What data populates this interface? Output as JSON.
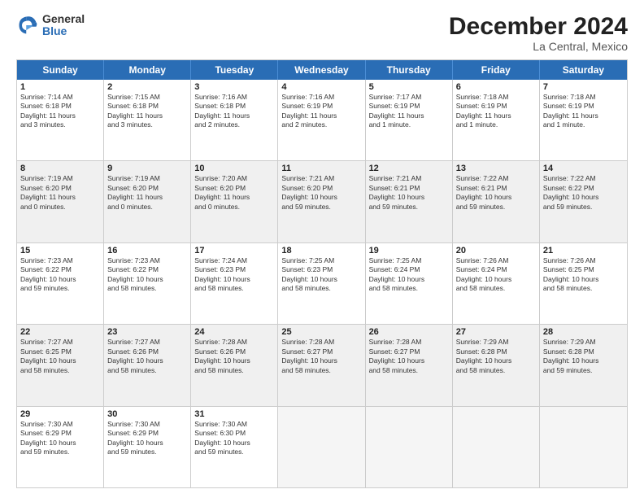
{
  "header": {
    "logo_general": "General",
    "logo_blue": "Blue",
    "title": "December 2024",
    "location": "La Central, Mexico"
  },
  "calendar": {
    "days": [
      "Sunday",
      "Monday",
      "Tuesday",
      "Wednesday",
      "Thursday",
      "Friday",
      "Saturday"
    ],
    "rows": [
      [
        {
          "day": "1",
          "lines": [
            "Sunrise: 7:14 AM",
            "Sunset: 6:18 PM",
            "Daylight: 11 hours",
            "and 3 minutes."
          ]
        },
        {
          "day": "2",
          "lines": [
            "Sunrise: 7:15 AM",
            "Sunset: 6:18 PM",
            "Daylight: 11 hours",
            "and 3 minutes."
          ]
        },
        {
          "day": "3",
          "lines": [
            "Sunrise: 7:16 AM",
            "Sunset: 6:18 PM",
            "Daylight: 11 hours",
            "and 2 minutes."
          ]
        },
        {
          "day": "4",
          "lines": [
            "Sunrise: 7:16 AM",
            "Sunset: 6:19 PM",
            "Daylight: 11 hours",
            "and 2 minutes."
          ]
        },
        {
          "day": "5",
          "lines": [
            "Sunrise: 7:17 AM",
            "Sunset: 6:19 PM",
            "Daylight: 11 hours",
            "and 1 minute."
          ]
        },
        {
          "day": "6",
          "lines": [
            "Sunrise: 7:18 AM",
            "Sunset: 6:19 PM",
            "Daylight: 11 hours",
            "and 1 minute."
          ]
        },
        {
          "day": "7",
          "lines": [
            "Sunrise: 7:18 AM",
            "Sunset: 6:19 PM",
            "Daylight: 11 hours",
            "and 1 minute."
          ]
        }
      ],
      [
        {
          "day": "8",
          "lines": [
            "Sunrise: 7:19 AM",
            "Sunset: 6:20 PM",
            "Daylight: 11 hours",
            "and 0 minutes."
          ]
        },
        {
          "day": "9",
          "lines": [
            "Sunrise: 7:19 AM",
            "Sunset: 6:20 PM",
            "Daylight: 11 hours",
            "and 0 minutes."
          ]
        },
        {
          "day": "10",
          "lines": [
            "Sunrise: 7:20 AM",
            "Sunset: 6:20 PM",
            "Daylight: 11 hours",
            "and 0 minutes."
          ]
        },
        {
          "day": "11",
          "lines": [
            "Sunrise: 7:21 AM",
            "Sunset: 6:20 PM",
            "Daylight: 10 hours",
            "and 59 minutes."
          ]
        },
        {
          "day": "12",
          "lines": [
            "Sunrise: 7:21 AM",
            "Sunset: 6:21 PM",
            "Daylight: 10 hours",
            "and 59 minutes."
          ]
        },
        {
          "day": "13",
          "lines": [
            "Sunrise: 7:22 AM",
            "Sunset: 6:21 PM",
            "Daylight: 10 hours",
            "and 59 minutes."
          ]
        },
        {
          "day": "14",
          "lines": [
            "Sunrise: 7:22 AM",
            "Sunset: 6:22 PM",
            "Daylight: 10 hours",
            "and 59 minutes."
          ]
        }
      ],
      [
        {
          "day": "15",
          "lines": [
            "Sunrise: 7:23 AM",
            "Sunset: 6:22 PM",
            "Daylight: 10 hours",
            "and 59 minutes."
          ]
        },
        {
          "day": "16",
          "lines": [
            "Sunrise: 7:23 AM",
            "Sunset: 6:22 PM",
            "Daylight: 10 hours",
            "and 58 minutes."
          ]
        },
        {
          "day": "17",
          "lines": [
            "Sunrise: 7:24 AM",
            "Sunset: 6:23 PM",
            "Daylight: 10 hours",
            "and 58 minutes."
          ]
        },
        {
          "day": "18",
          "lines": [
            "Sunrise: 7:25 AM",
            "Sunset: 6:23 PM",
            "Daylight: 10 hours",
            "and 58 minutes."
          ]
        },
        {
          "day": "19",
          "lines": [
            "Sunrise: 7:25 AM",
            "Sunset: 6:24 PM",
            "Daylight: 10 hours",
            "and 58 minutes."
          ]
        },
        {
          "day": "20",
          "lines": [
            "Sunrise: 7:26 AM",
            "Sunset: 6:24 PM",
            "Daylight: 10 hours",
            "and 58 minutes."
          ]
        },
        {
          "day": "21",
          "lines": [
            "Sunrise: 7:26 AM",
            "Sunset: 6:25 PM",
            "Daylight: 10 hours",
            "and 58 minutes."
          ]
        }
      ],
      [
        {
          "day": "22",
          "lines": [
            "Sunrise: 7:27 AM",
            "Sunset: 6:25 PM",
            "Daylight: 10 hours",
            "and 58 minutes."
          ]
        },
        {
          "day": "23",
          "lines": [
            "Sunrise: 7:27 AM",
            "Sunset: 6:26 PM",
            "Daylight: 10 hours",
            "and 58 minutes."
          ]
        },
        {
          "day": "24",
          "lines": [
            "Sunrise: 7:28 AM",
            "Sunset: 6:26 PM",
            "Daylight: 10 hours",
            "and 58 minutes."
          ]
        },
        {
          "day": "25",
          "lines": [
            "Sunrise: 7:28 AM",
            "Sunset: 6:27 PM",
            "Daylight: 10 hours",
            "and 58 minutes."
          ]
        },
        {
          "day": "26",
          "lines": [
            "Sunrise: 7:28 AM",
            "Sunset: 6:27 PM",
            "Daylight: 10 hours",
            "and 58 minutes."
          ]
        },
        {
          "day": "27",
          "lines": [
            "Sunrise: 7:29 AM",
            "Sunset: 6:28 PM",
            "Daylight: 10 hours",
            "and 58 minutes."
          ]
        },
        {
          "day": "28",
          "lines": [
            "Sunrise: 7:29 AM",
            "Sunset: 6:28 PM",
            "Daylight: 10 hours",
            "and 59 minutes."
          ]
        }
      ],
      [
        {
          "day": "29",
          "lines": [
            "Sunrise: 7:30 AM",
            "Sunset: 6:29 PM",
            "Daylight: 10 hours",
            "and 59 minutes."
          ]
        },
        {
          "day": "30",
          "lines": [
            "Sunrise: 7:30 AM",
            "Sunset: 6:29 PM",
            "Daylight: 10 hours",
            "and 59 minutes."
          ]
        },
        {
          "day": "31",
          "lines": [
            "Sunrise: 7:30 AM",
            "Sunset: 6:30 PM",
            "Daylight: 10 hours",
            "and 59 minutes."
          ]
        },
        {
          "day": "",
          "lines": []
        },
        {
          "day": "",
          "lines": []
        },
        {
          "day": "",
          "lines": []
        },
        {
          "day": "",
          "lines": []
        }
      ]
    ]
  }
}
